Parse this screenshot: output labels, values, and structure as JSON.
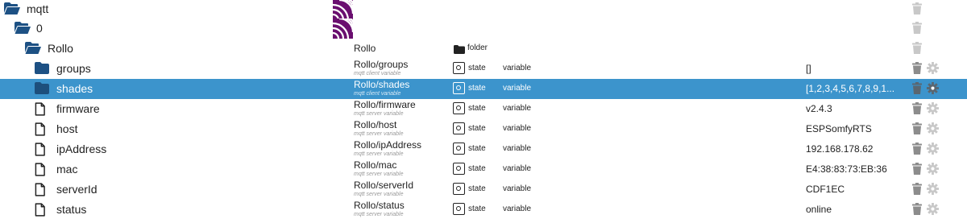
{
  "tree": {
    "rows": [
      {
        "name": "mqtt",
        "type": "folder-open",
        "icon": "folder-open-icon",
        "adapter_icon": "mqtt-adapter-icon"
      },
      {
        "name": "0",
        "type": "folder-open",
        "icon": "folder-open-icon",
        "adapter_icon": "mqtt-adapter-icon"
      },
      {
        "name": "Rollo",
        "type": "folder-open",
        "icon": "folder-open-icon",
        "id": "Rollo",
        "obj_type": "folder"
      },
      {
        "name": "groups",
        "type": "folder",
        "icon": "folder-icon",
        "id": "Rollo/groups",
        "desc": "mqtt client variable",
        "obj_type": "state",
        "role": "variable",
        "value": "[]"
      },
      {
        "name": "shades",
        "type": "folder",
        "icon": "folder-icon",
        "id": "Rollo/shades",
        "desc": "mqtt client variable",
        "obj_type": "state",
        "role": "variable",
        "value": "[1,2,3,4,5,6,7,8,9,1...",
        "selected": true
      },
      {
        "name": "firmware",
        "type": "file",
        "icon": "file-icon",
        "id": "Rollo/firmware",
        "desc": "mqtt server variable",
        "obj_type": "state",
        "role": "variable",
        "value": "v2.4.3"
      },
      {
        "name": "host",
        "type": "file",
        "icon": "file-icon",
        "id": "Rollo/host",
        "desc": "mqtt server variable",
        "obj_type": "state",
        "role": "variable",
        "value": "ESPSomfyRTS"
      },
      {
        "name": "ipAddress",
        "type": "file",
        "icon": "file-icon",
        "id": "Rollo/ipAddress",
        "desc": "mqtt server variable",
        "obj_type": "state",
        "role": "variable",
        "value": "192.168.178.62"
      },
      {
        "name": "mac",
        "type": "file",
        "icon": "file-icon",
        "id": "Rollo/mac",
        "desc": "mqtt server variable",
        "obj_type": "state",
        "role": "variable",
        "value": "E4:38:83:73:EB:36"
      },
      {
        "name": "serverId",
        "type": "file",
        "icon": "file-icon",
        "id": "Rollo/serverId",
        "desc": "mqtt server variable",
        "obj_type": "state",
        "role": "variable",
        "value": "CDF1EC"
      },
      {
        "name": "status",
        "type": "file",
        "icon": "file-icon",
        "id": "Rollo/status",
        "desc": "mqtt server variable",
        "obj_type": "state",
        "role": "variable",
        "value": "online"
      }
    ]
  },
  "colors": {
    "selected_row_bg": "#3c94cc",
    "folder_icon": "#1d5184",
    "mqtt_icon": "#6a0e6f",
    "action_icon_inactive": "#c8c8c8",
    "action_icon_active": "#8c8c8c"
  }
}
